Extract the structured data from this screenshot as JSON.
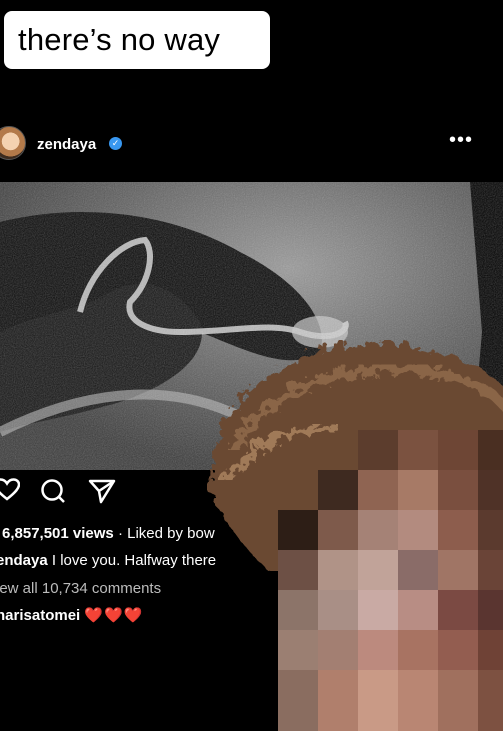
{
  "overlay_caption": "there’s no way",
  "post": {
    "username": "zendaya",
    "more_icon": "•••",
    "views_text": "6,857,501 views",
    "liked_by_text": "· Liked by bow",
    "caption_username": "endaya",
    "caption_text": "I love you. Halfway there",
    "view_all_text": "iew all 10,734 comments",
    "comment_username": "narisatomei",
    "comment_hearts": "❤️❤️❤️"
  },
  "icons": [
    "verified-badge-icon",
    "heart-icon",
    "comment-icon",
    "share-icon",
    "more-options-icon"
  ],
  "colors": {
    "background": "#000000",
    "caption_bg": "#ffffff",
    "verified": "#3897f0",
    "hearts": "#e0243a"
  }
}
